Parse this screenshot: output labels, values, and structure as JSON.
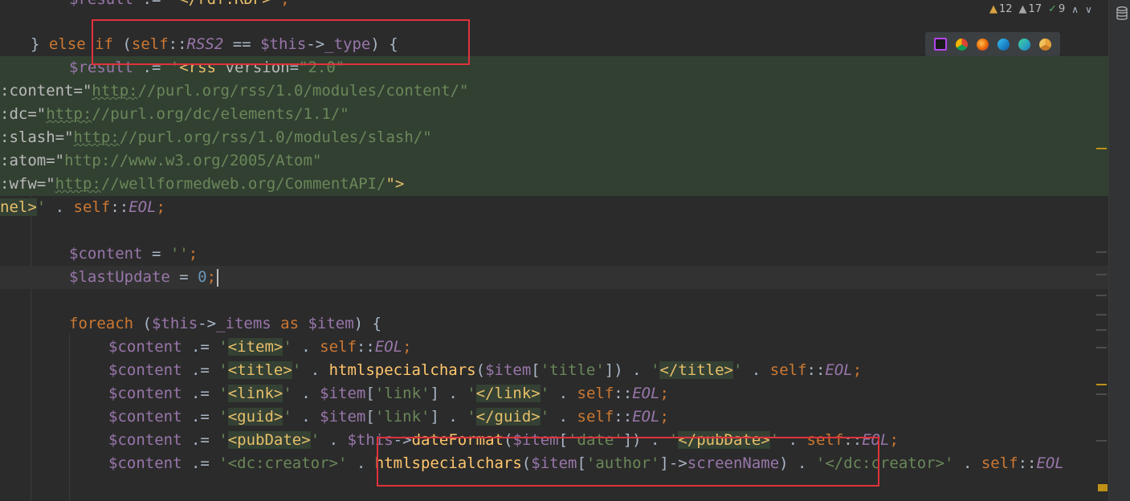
{
  "inspections": {
    "warnings": "12",
    "weak_warnings": "17",
    "typos": "9",
    "prev_label": "∧",
    "next_label": "∨"
  },
  "browsers": [
    "phpstorm-icon",
    "chrome-icon",
    "firefox-icon",
    "edge-icon",
    "edge-beta-icon",
    "chrome-canary-icon"
  ],
  "code": {
    "l0": [
      "$result",
      " .= ",
      "'",
      "</rdf:RDF>",
      "'",
      ";"
    ],
    "l1": [
      "} ",
      "else ",
      "if ",
      "(",
      "self",
      "::",
      "RSS2",
      " == ",
      "$this",
      "->",
      "_type",
      ") {"
    ],
    "l2": [
      "$result",
      " .= ",
      "'",
      "<rss ",
      "version",
      "=",
      "\"2.0\""
    ],
    "l3": [
      ":content=\"",
      "http:",
      "//purl.org/rss/1.0/modules/content/",
      "\""
    ],
    "l4": [
      ":dc=\"",
      "http:",
      "//purl.org/dc/elements/1.1/",
      "\""
    ],
    "l5": [
      ":slash=\"",
      "http:",
      "//purl.org/rss/1.0/modules/slash/",
      "\""
    ],
    "l6": [
      ":atom=\"",
      "http://www.w3.org/2005/Atom",
      "\""
    ],
    "l7": [
      ":wfw=\"",
      "http:",
      "//wellformedweb.org/CommentAPI/",
      "\">"
    ],
    "l8": [
      "nel>",
      "'",
      " . ",
      "self",
      "::",
      "EOL",
      ";"
    ],
    "l10": [
      "$content",
      " = ",
      "''",
      ";"
    ],
    "l11": [
      "$lastUpdate",
      " = ",
      "0",
      ";"
    ],
    "l13": [
      "foreach ",
      "(",
      "$this",
      "->",
      "_items",
      " as ",
      "$item",
      ") {"
    ],
    "l14": [
      "$content",
      " .= ",
      "'",
      "<item>",
      "'",
      " . ",
      "self",
      "::",
      "EOL",
      ";"
    ],
    "l15": [
      "$content",
      " .= ",
      "'",
      "<title>",
      "'",
      " . ",
      "htmlspecialchars",
      "(",
      "$item",
      "[",
      "'title'",
      "]) . ",
      "'",
      "</title>",
      "'",
      " . ",
      "self",
      "::",
      "EOL",
      ";"
    ],
    "l16": [
      "$content",
      " .= ",
      "'",
      "<link>",
      "'",
      " . ",
      "$item",
      "[",
      "'link'",
      "] . ",
      "'",
      "</link>",
      "'",
      " . ",
      "self",
      "::",
      "EOL",
      ";"
    ],
    "l17": [
      "$content",
      " .= ",
      "'",
      "<guid>",
      "'",
      " . ",
      "$item",
      "[",
      "'link'",
      "] . ",
      "'",
      "</guid>",
      "'",
      " . ",
      "self",
      "::",
      "EOL",
      ";"
    ],
    "l18": [
      "$content",
      " .= ",
      "'",
      "<pubDate>",
      "'",
      " . ",
      "$this",
      "->",
      "dateFormat",
      "(",
      "$item",
      "[",
      "'date'",
      "]) . ",
      "'",
      "</pubDate>",
      "'",
      " . ",
      "self",
      "::",
      "EOL",
      ";"
    ],
    "l19": [
      "$content",
      " .= ",
      "'<dc:creator>'",
      " . ",
      "htmlspecialchars",
      "(",
      "$item",
      "[",
      "'author'",
      "]->",
      "screenName",
      ") . ",
      "'</dc:creator>'",
      " . ",
      "self",
      "::",
      "EOL"
    ]
  }
}
